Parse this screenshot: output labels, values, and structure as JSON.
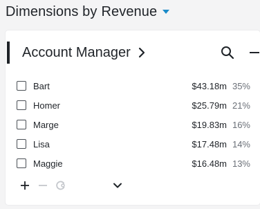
{
  "header": {
    "title": "Dimensions by",
    "metric": "Revenue",
    "dropdown_icon": "caret-down-icon",
    "caret_color": "#1a8ac8"
  },
  "panel": {
    "title": "Account Manager",
    "icons": {
      "expand": "chevron-right-icon",
      "search": "search-icon",
      "collapse": "minus-icon"
    },
    "rows": [
      {
        "name": "Bart",
        "value": "$43.18m",
        "pct": "35%",
        "checked": false
      },
      {
        "name": "Homer",
        "value": "$25.79m",
        "pct": "21%",
        "checked": false
      },
      {
        "name": "Marge",
        "value": "$19.83m",
        "pct": "16%",
        "checked": false
      },
      {
        "name": "Lisa",
        "value": "$17.48m",
        "pct": "14%",
        "checked": false
      },
      {
        "name": "Maggie",
        "value": "$16.48m",
        "pct": "13%",
        "checked": false
      }
    ],
    "footer_icons": [
      "plus-icon",
      "minus-icon",
      "refresh-icon",
      "chevron-down-icon"
    ]
  }
}
